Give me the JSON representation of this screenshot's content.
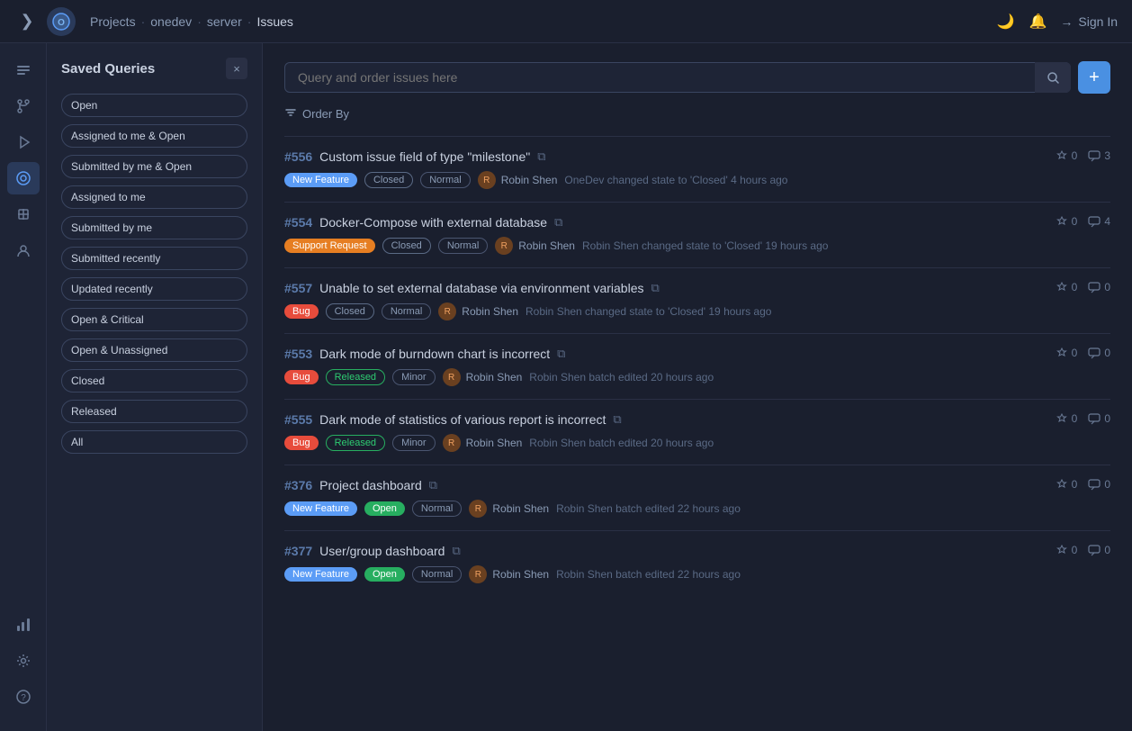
{
  "topnav": {
    "logo_text": "O",
    "breadcrumbs": [
      {
        "label": "Projects",
        "active": false
      },
      {
        "label": "onedev",
        "active": false
      },
      {
        "label": "server",
        "active": false
      },
      {
        "label": "Issues",
        "active": true
      }
    ],
    "signin_label": "Sign In"
  },
  "sidebar": {
    "close_label": "×",
    "title": "Saved Queries",
    "queries": [
      {
        "label": "Open"
      },
      {
        "label": "Assigned to me & Open"
      },
      {
        "label": "Submitted by me & Open"
      },
      {
        "label": "Assigned to me"
      },
      {
        "label": "Submitted by me"
      },
      {
        "label": "Submitted recently"
      },
      {
        "label": "Updated recently"
      },
      {
        "label": "Open & Critical"
      },
      {
        "label": "Open & Unassigned"
      },
      {
        "label": "Closed"
      },
      {
        "label": "Released"
      },
      {
        "label": "All"
      }
    ]
  },
  "search": {
    "placeholder": "Query and order issues here"
  },
  "order_by": "Order By",
  "add_button_label": "+",
  "issues": [
    {
      "number": "#556",
      "title": "Custom issue field of type \"milestone\"",
      "votes": "0",
      "comments": "3",
      "tags": [
        {
          "label": "New Feature",
          "type": "new-feature"
        },
        {
          "label": "Closed",
          "type": "closed"
        },
        {
          "label": "Normal",
          "type": "normal"
        }
      ],
      "assignee": "Robin Shen",
      "avatar_type": "orange",
      "activity": "OneDev changed state to 'Closed' 4 hours ago",
      "activity_actor": "OneDev"
    },
    {
      "number": "#554",
      "title": "Docker-Compose with external database",
      "votes": "0",
      "comments": "4",
      "tags": [
        {
          "label": "Support Request",
          "type": "support"
        },
        {
          "label": "Closed",
          "type": "closed"
        },
        {
          "label": "Normal",
          "type": "normal"
        }
      ],
      "assignee": "Robin Shen",
      "avatar_type": "orange",
      "activity": "Robin Shen changed state to 'Closed' 19 hours ago",
      "activity_actor": "Robin Shen"
    },
    {
      "number": "#557",
      "title": "Unable to set external database via environment variables",
      "votes": "0",
      "comments": "0",
      "tags": [
        {
          "label": "Bug",
          "type": "bug"
        },
        {
          "label": "Closed",
          "type": "closed"
        },
        {
          "label": "Normal",
          "type": "normal"
        }
      ],
      "assignee": "Robin Shen",
      "avatar_type": "orange",
      "activity": "Robin Shen changed state to 'Closed' 19 hours ago",
      "activity_actor": "Robin Shen"
    },
    {
      "number": "#553",
      "title": "Dark mode of burndown chart is incorrect",
      "votes": "0",
      "comments": "0",
      "tags": [
        {
          "label": "Bug",
          "type": "bug"
        },
        {
          "label": "Released",
          "type": "released"
        },
        {
          "label": "Minor",
          "type": "minor"
        }
      ],
      "assignee": "Robin Shen",
      "avatar_type": "orange",
      "activity": "Robin Shen batch edited 20 hours ago",
      "activity_actor": "Robin Shen"
    },
    {
      "number": "#555",
      "title": "Dark mode of statistics of various report is incorrect",
      "votes": "0",
      "comments": "0",
      "tags": [
        {
          "label": "Bug",
          "type": "bug"
        },
        {
          "label": "Released",
          "type": "released"
        },
        {
          "label": "Minor",
          "type": "minor"
        }
      ],
      "assignee": "Robin Shen",
      "avatar_type": "orange",
      "activity": "Robin Shen batch edited 20 hours ago",
      "activity_actor": "Robin Shen"
    },
    {
      "number": "#376",
      "title": "Project dashboard",
      "votes": "0",
      "comments": "0",
      "tags": [
        {
          "label": "New Feature",
          "type": "new-feature"
        },
        {
          "label": "Open",
          "type": "open"
        },
        {
          "label": "Normal",
          "type": "normal"
        }
      ],
      "assignee": "Robin Shen",
      "avatar_type": "orange",
      "activity": "Robin Shen batch edited 22 hours ago",
      "activity_actor": "Robin Shen"
    },
    {
      "number": "#377",
      "title": "User/group dashboard",
      "votes": "0",
      "comments": "0",
      "tags": [
        {
          "label": "New Feature",
          "type": "new-feature"
        },
        {
          "label": "Open",
          "type": "open"
        },
        {
          "label": "Normal",
          "type": "normal"
        }
      ],
      "assignee": "Robin Shen",
      "avatar_type": "orange",
      "activity": "Robin Shen batch edited 22 hours ago",
      "activity_actor": "Robin Shen"
    }
  ],
  "icons": {
    "sidebar_toggle": "❯",
    "search": "🔍",
    "order_by": "⇅",
    "copy": "⧉",
    "thumb_up": "👍",
    "comment": "💬",
    "moon": "🌙",
    "bell": "🔔",
    "sign_in": "→",
    "home": "⌂",
    "git": "⌥",
    "build": "▶",
    "deploy": "⬆",
    "issues": "◈",
    "milestone": "◎",
    "stats": "▦",
    "settings": "⚙",
    "help": "?"
  }
}
